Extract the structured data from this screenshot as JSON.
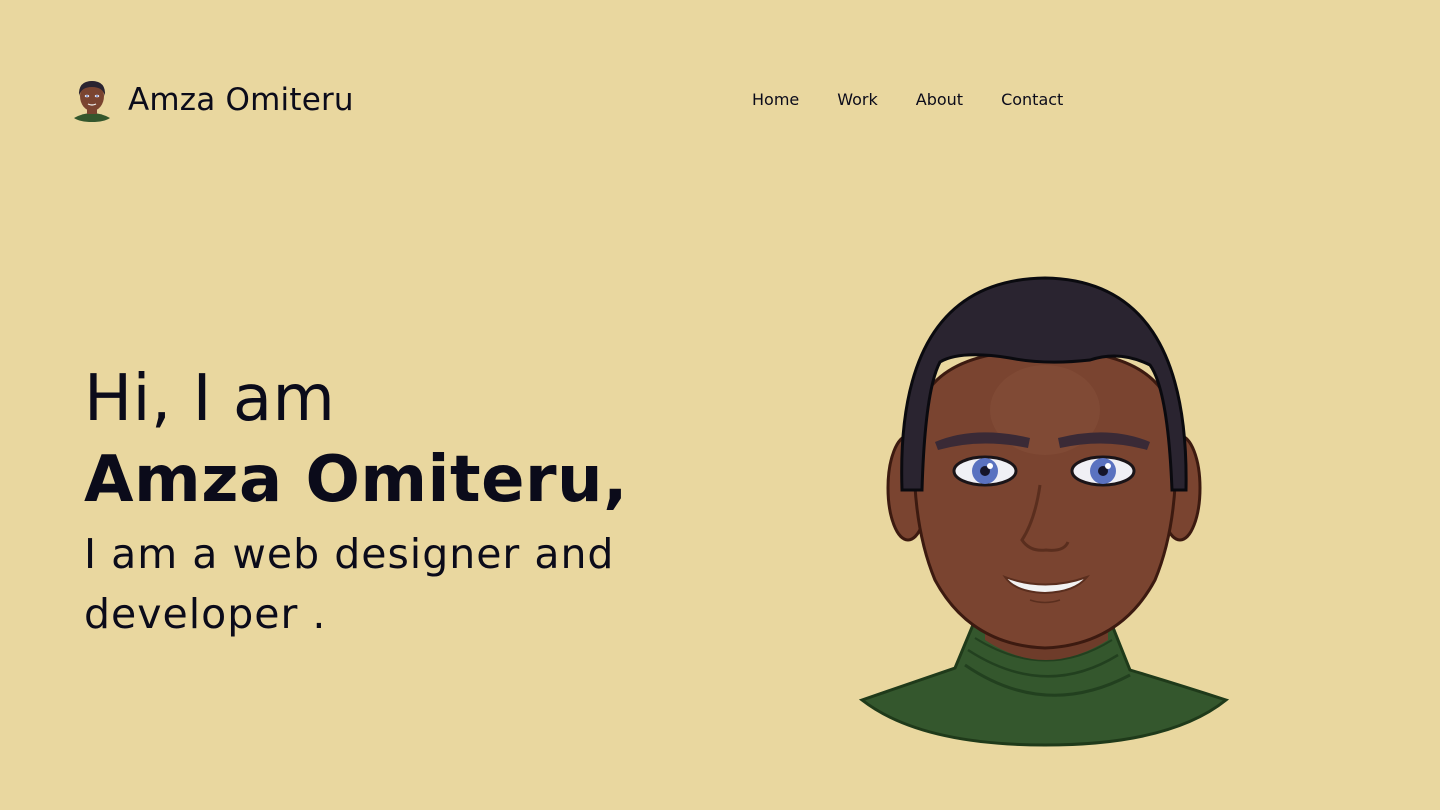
{
  "header": {
    "brand_name": "Amza Omiteru",
    "avatar_icon": "avatar-icon"
  },
  "nav": {
    "items": [
      {
        "label": "Home"
      },
      {
        "label": "Work"
      },
      {
        "label": "About"
      },
      {
        "label": "Contact"
      }
    ]
  },
  "hero": {
    "greeting": "Hi, I am",
    "name": "Amza Omiteru,",
    "tagline": "I am a web designer and developer ."
  },
  "colors": {
    "background": "#e9d79f",
    "text": "#0b0b1a",
    "skin": "#7a4430",
    "hair": "#2a2430",
    "shirt": "#34572d",
    "eyes": "#5a72c0"
  }
}
